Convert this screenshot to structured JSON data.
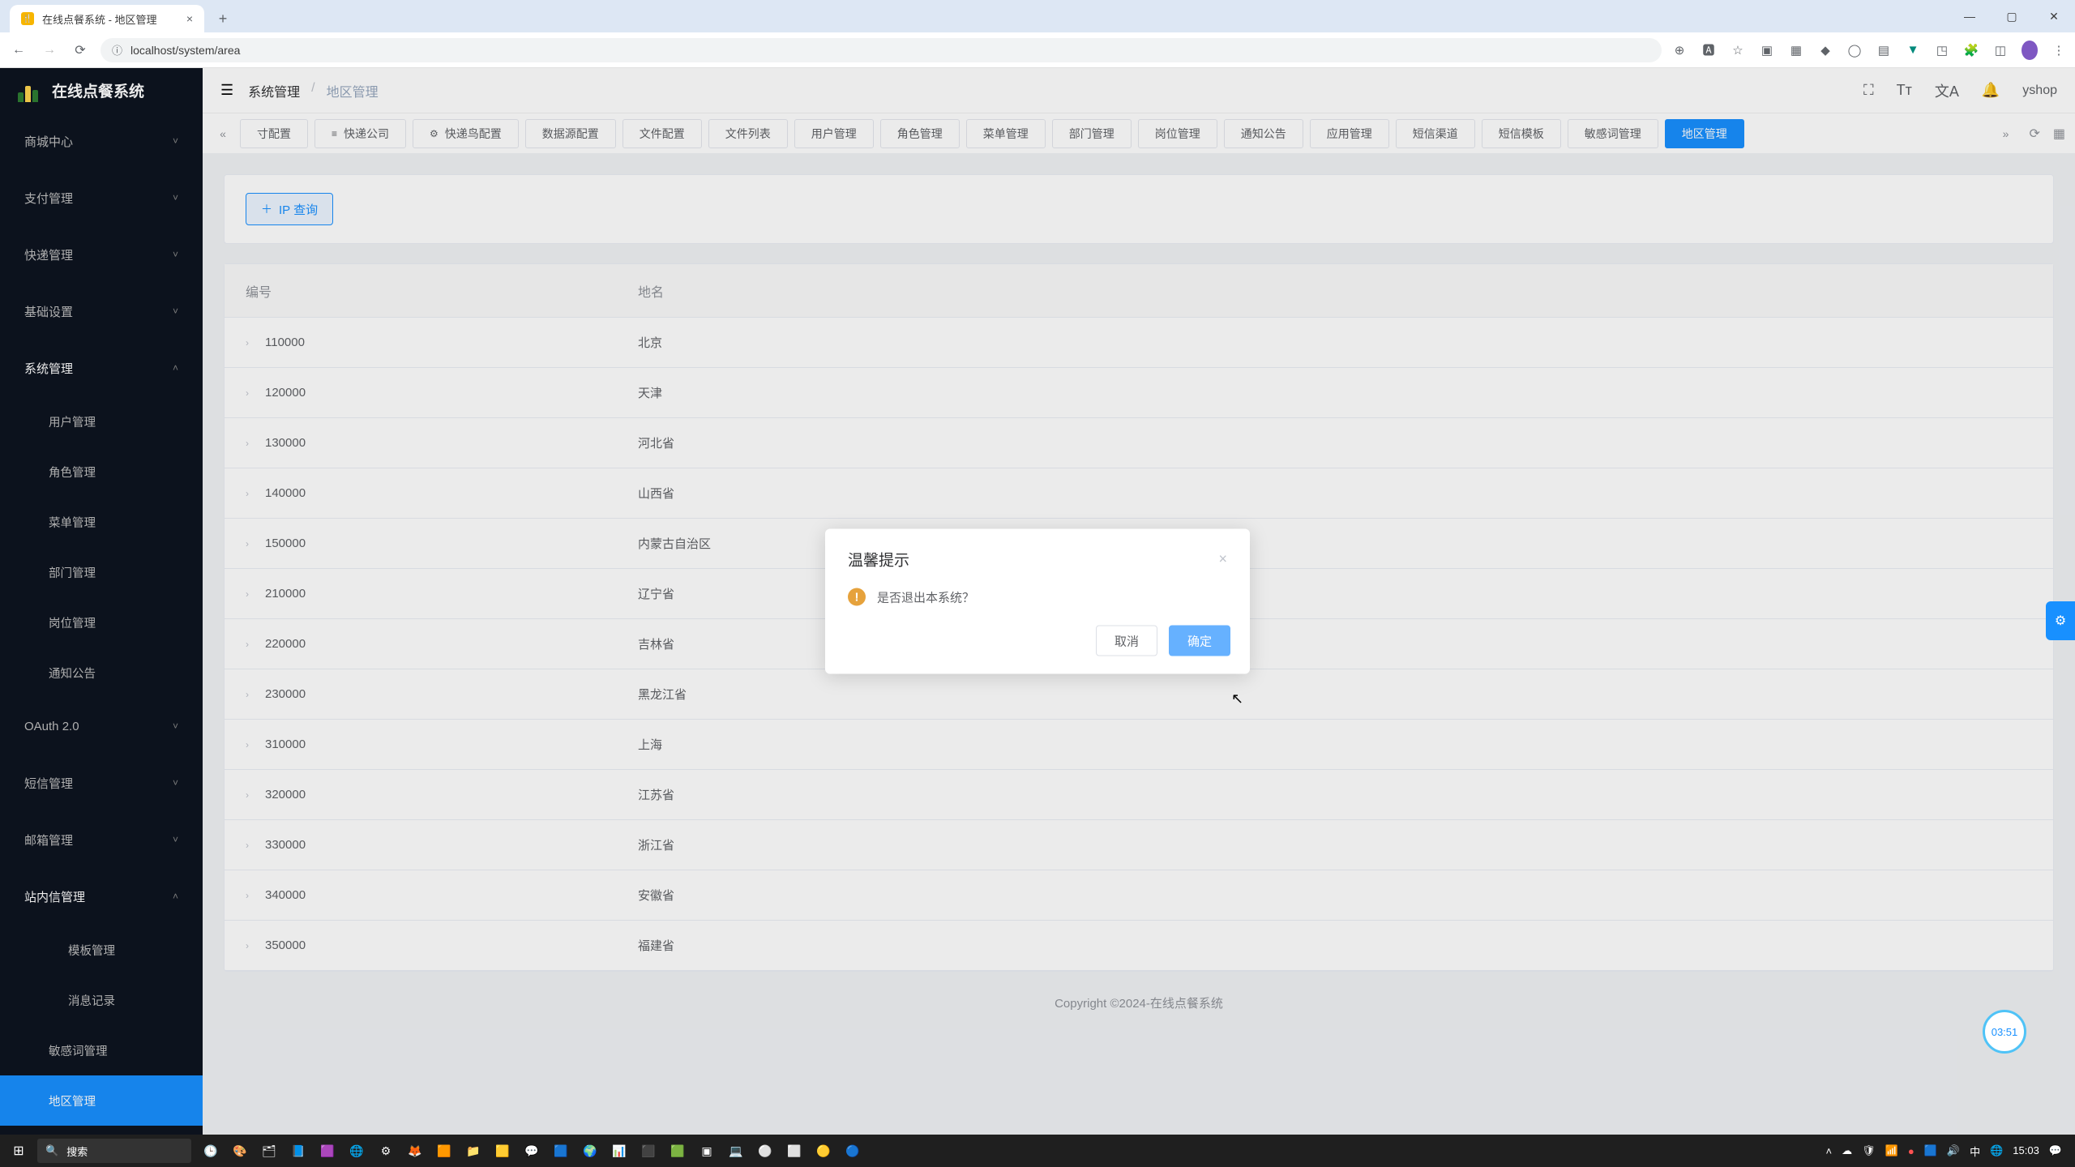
{
  "browser": {
    "tab_title": "在线点餐系统 - 地区管理",
    "url": "localhost/system/area"
  },
  "brand": "在线点餐系统",
  "sidebar": [
    {
      "label": "商城中心",
      "type": "group"
    },
    {
      "label": "支付管理",
      "type": "group"
    },
    {
      "label": "快递管理",
      "type": "group"
    },
    {
      "label": "基础设置",
      "type": "group"
    },
    {
      "label": "系统管理",
      "type": "group",
      "open": true
    },
    {
      "label": "用户管理",
      "type": "sub"
    },
    {
      "label": "角色管理",
      "type": "sub"
    },
    {
      "label": "菜单管理",
      "type": "sub"
    },
    {
      "label": "部门管理",
      "type": "sub"
    },
    {
      "label": "岗位管理",
      "type": "sub"
    },
    {
      "label": "通知公告",
      "type": "sub"
    },
    {
      "label": "OAuth 2.0",
      "type": "group"
    },
    {
      "label": "短信管理",
      "type": "group"
    },
    {
      "label": "邮箱管理",
      "type": "group"
    },
    {
      "label": "站内信管理",
      "type": "group",
      "open": true
    },
    {
      "label": "模板管理",
      "type": "subsub"
    },
    {
      "label": "消息记录",
      "type": "subsub"
    },
    {
      "label": "敏感词管理",
      "type": "sub"
    },
    {
      "label": "地区管理",
      "type": "sub",
      "active": true
    }
  ],
  "breadcrumb": {
    "root": "系统管理",
    "current": "地区管理"
  },
  "user": "yshop",
  "page_tabs": [
    {
      "label": "寸配置",
      "icon": ""
    },
    {
      "label": "快递公司",
      "icon": "≡"
    },
    {
      "label": "快递鸟配置",
      "icon": "⚙"
    },
    {
      "label": "数据源配置"
    },
    {
      "label": "文件配置"
    },
    {
      "label": "文件列表"
    },
    {
      "label": "用户管理"
    },
    {
      "label": "角色管理"
    },
    {
      "label": "菜单管理"
    },
    {
      "label": "部门管理"
    },
    {
      "label": "岗位管理"
    },
    {
      "label": "通知公告"
    },
    {
      "label": "应用管理"
    },
    {
      "label": "短信渠道"
    },
    {
      "label": "短信模板"
    },
    {
      "label": "敏感词管理"
    },
    {
      "label": "地区管理",
      "active": true
    }
  ],
  "action_button": "IP 查询",
  "table": {
    "headers": {
      "code": "编号",
      "name": "地名"
    },
    "rows": [
      {
        "code": "110000",
        "name": "北京"
      },
      {
        "code": "120000",
        "name": "天津"
      },
      {
        "code": "130000",
        "name": "河北省"
      },
      {
        "code": "140000",
        "name": "山西省"
      },
      {
        "code": "150000",
        "name": "内蒙古自治区"
      },
      {
        "code": "210000",
        "name": "辽宁省"
      },
      {
        "code": "220000",
        "name": "吉林省"
      },
      {
        "code": "230000",
        "name": "黑龙江省"
      },
      {
        "code": "310000",
        "name": "上海"
      },
      {
        "code": "320000",
        "name": "江苏省"
      },
      {
        "code": "330000",
        "name": "浙江省"
      },
      {
        "code": "340000",
        "name": "安徽省"
      },
      {
        "code": "350000",
        "name": "福建省"
      }
    ]
  },
  "footer": "Copyright ©2024-在线点餐系统",
  "modal": {
    "title": "温馨提示",
    "body": "是否退出本系统？",
    "cancel": "取消",
    "confirm": "确定"
  },
  "timer": "03:51",
  "taskbar": {
    "search_placeholder": "搜索",
    "ime": "中",
    "time": "15:03",
    "date": ""
  }
}
